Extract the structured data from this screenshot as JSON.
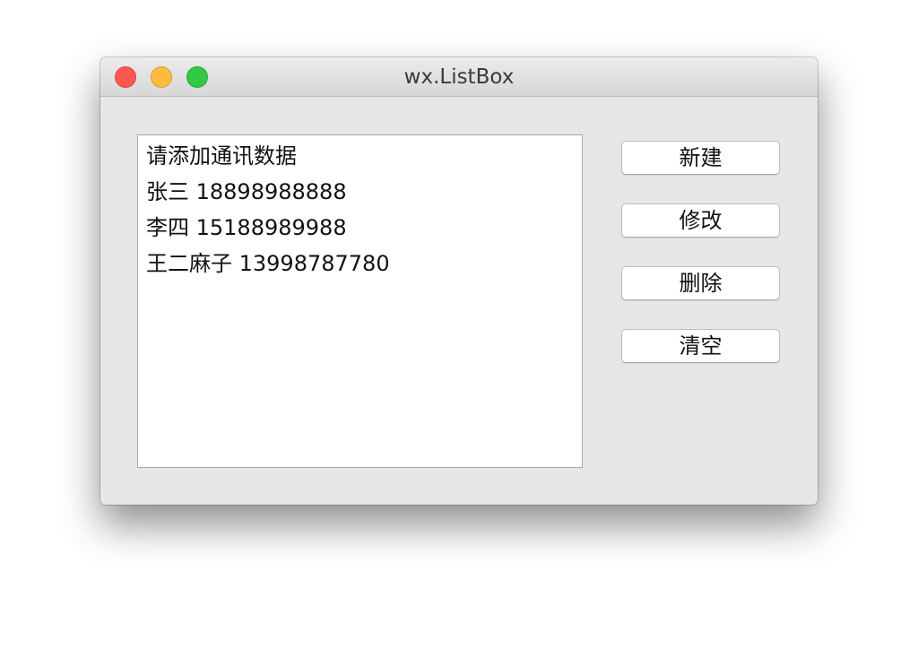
{
  "window": {
    "title": "wx.ListBox"
  },
  "listbox": {
    "items": [
      "请添加通讯数据",
      "张三 18898988888",
      "李四 15188989988",
      "王二麻子 13998787780"
    ]
  },
  "buttons": {
    "new_label": "新建",
    "edit_label": "修改",
    "delete_label": "删除",
    "clear_label": "清空"
  },
  "colors": {
    "close": "#fc5753",
    "minimize": "#fdbc40",
    "zoom": "#33c748"
  }
}
